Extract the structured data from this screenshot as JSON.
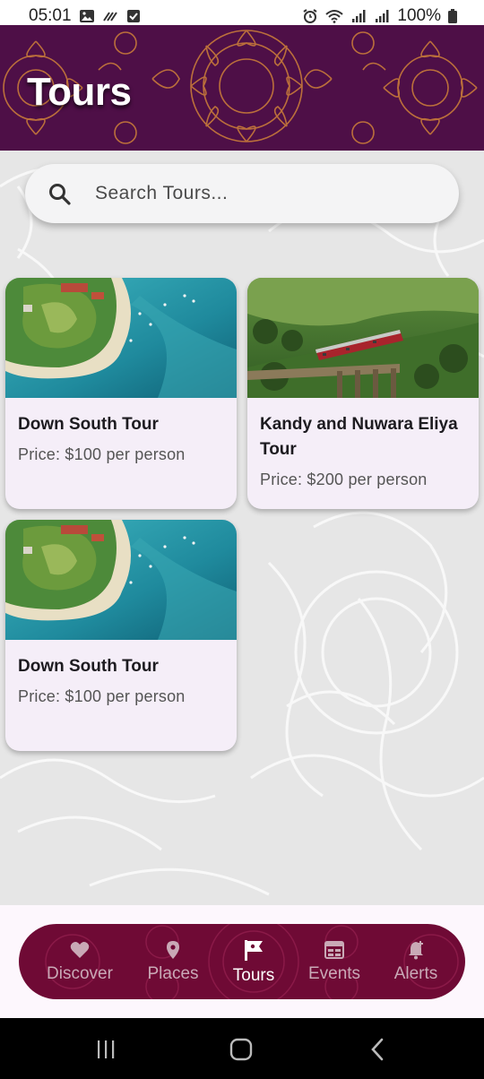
{
  "status_bar": {
    "time": "05:01",
    "battery": "100%"
  },
  "header": {
    "title": "Tours"
  },
  "search": {
    "placeholder": "Search Tours..."
  },
  "tours": [
    {
      "title": "Down South Tour",
      "price": "Price: $100 per person",
      "image": "beach-aerial-image"
    },
    {
      "title": "Kandy and Nuwara Eliya Tour",
      "price": "Price: $200 per person",
      "image": "train-bridge-image"
    },
    {
      "title": "Down South Tour",
      "price": "Price: $100 per person",
      "image": "beach-aerial-image"
    }
  ],
  "nav": {
    "items": [
      {
        "label": "Discover",
        "icon": "heart-icon"
      },
      {
        "label": "Places",
        "icon": "location-pin-icon"
      },
      {
        "label": "Tours",
        "icon": "flag-icon"
      },
      {
        "label": "Events",
        "icon": "calendar-grid-icon"
      },
      {
        "label": "Alerts",
        "icon": "bell-add-icon"
      }
    ],
    "active": "Tours"
  },
  "colors": {
    "header_bg": "#4e0f47",
    "header_pattern": "#c77a3a",
    "nav_bg": "#6f0a35",
    "card_bg": "#f5eef8"
  }
}
